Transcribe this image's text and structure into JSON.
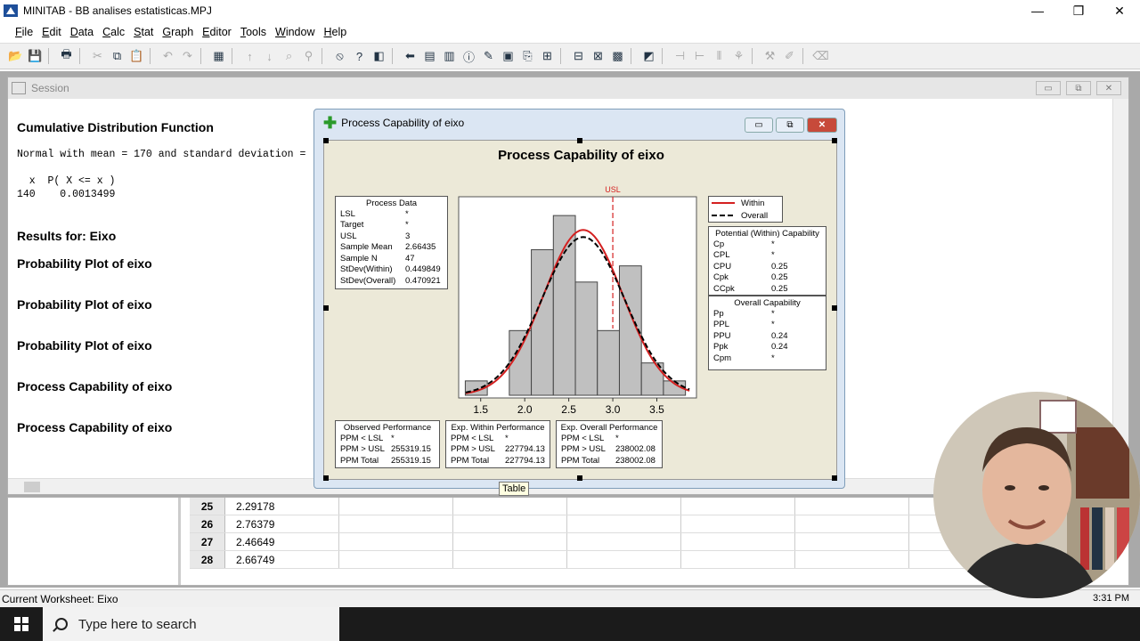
{
  "window": {
    "title": "MINITAB - BB analises estatisticas.MPJ",
    "min": "—",
    "max": "❐",
    "close": "✕"
  },
  "menu": [
    "File",
    "Edit",
    "Data",
    "Calc",
    "Stat",
    "Graph",
    "Editor",
    "Tools",
    "Window",
    "Help"
  ],
  "session": {
    "title": "Session",
    "h1": "Cumulative Distribution Function",
    "line1": "Normal with mean = 170 and standard deviation =",
    "line2": "  x  P( X <= x )",
    "line3": "140    0.0013499",
    "results": "Results for: Eixo",
    "items": [
      "Probability Plot of eixo",
      "Probability Plot of eixo",
      "Probability Plot of eixo",
      "Process Capability of eixo",
      "Process Capability of eixo"
    ]
  },
  "capability": {
    "window_title": "Process Capability of eixo",
    "graph_title": "Process Capability of eixo",
    "process_data": {
      "title": "Process Data",
      "rows": [
        {
          "label": "LSL",
          "value": "*"
        },
        {
          "label": "Target",
          "value": "*"
        },
        {
          "label": "USL",
          "value": "3"
        },
        {
          "label": "Sample Mean",
          "value": "2.66435"
        },
        {
          "label": "Sample N",
          "value": "47"
        },
        {
          "label": "StDev(Within)",
          "value": "0.449849"
        },
        {
          "label": "StDev(Overall)",
          "value": "0.470921"
        }
      ]
    },
    "legend": {
      "within": "Within",
      "overall": "Overall",
      "within_color": "#d42020",
      "overall_color": "#000000"
    },
    "potential": {
      "title": "Potential (Within) Capability",
      "rows": [
        {
          "label": "Cp",
          "value": "*"
        },
        {
          "label": "CPL",
          "value": "*"
        },
        {
          "label": "CPU",
          "value": "0.25"
        },
        {
          "label": "Cpk",
          "value": "0.25"
        },
        {
          "label": "CCpk",
          "value": "0.25"
        }
      ]
    },
    "overall": {
      "title": "Overall Capability",
      "rows": [
        {
          "label": "Pp",
          "value": "*"
        },
        {
          "label": "PPL",
          "value": "*"
        },
        {
          "label": "PPU",
          "value": "0.24"
        },
        {
          "label": "Ppk",
          "value": "0.24"
        },
        {
          "label": "Cpm",
          "value": "*"
        }
      ]
    },
    "observed": {
      "title": "Observed Performance",
      "rows": [
        {
          "label": "PPM < LSL",
          "value": "*"
        },
        {
          "label": "PPM > USL",
          "value": "255319.15"
        },
        {
          "label": "PPM Total",
          "value": "255319.15"
        }
      ]
    },
    "exp_within": {
      "title": "Exp. Within Performance",
      "rows": [
        {
          "label": "PPM < LSL",
          "value": "*"
        },
        {
          "label": "PPM > USL",
          "value": "227794.13"
        },
        {
          "label": "PPM Total",
          "value": "227794.13"
        }
      ]
    },
    "exp_overall": {
      "title": "Exp. Overall Performance",
      "rows": [
        {
          "label": "PPM < LSL",
          "value": "*"
        },
        {
          "label": "PPM > USL",
          "value": "238002.08"
        },
        {
          "label": "PPM Total",
          "value": "238002.08"
        }
      ]
    },
    "tooltip": "Table"
  },
  "chart_data": {
    "type": "bar",
    "title": "Process Capability of eixo",
    "xlim": [
      1.25,
      3.95
    ],
    "ylim": [
      0,
      1.06
    ],
    "xticks": [
      "1.5",
      "2.0",
      "2.5",
      "3.0",
      "3.5"
    ],
    "bin_edges": [
      1.325,
      1.575,
      1.825,
      2.075,
      2.325,
      2.575,
      2.825,
      3.075,
      3.325,
      3.575,
      3.825
    ],
    "bin_heights": [
      0.08,
      0.0,
      0.36,
      0.81,
      1.0,
      0.63,
      0.36,
      0.72,
      0.18,
      0.08
    ],
    "usl": 3.0,
    "usl_label": "USL",
    "within": {
      "mean": 2.66435,
      "sd": 0.449849
    },
    "overall": {
      "mean": 2.66435,
      "sd": 0.470921
    },
    "series": [
      {
        "name": "Within"
      },
      {
        "name": "Overall"
      }
    ]
  },
  "worksheet": {
    "rows": [
      {
        "n": "25",
        "v": "2.29178"
      },
      {
        "n": "26",
        "v": "2.76379"
      },
      {
        "n": "27",
        "v": "2.46649"
      },
      {
        "n": "28",
        "v": "2.66749"
      }
    ]
  },
  "status": {
    "text": "Current Worksheet: Eixo",
    "time": "3:31 PM"
  },
  "taskbar": {
    "search_placeholder": "Type here to search"
  }
}
